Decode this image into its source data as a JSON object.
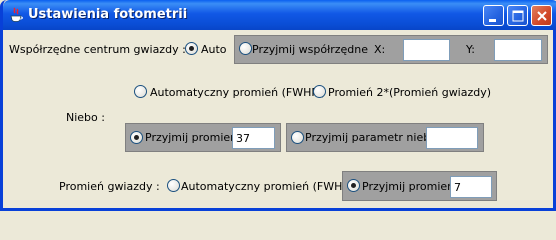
{
  "window": {
    "title": "Ustawienia fotometrii",
    "controls": [
      "minimize-icon",
      "maximize-icon",
      "close-icon"
    ]
  },
  "star_center": {
    "label": "Współrzędne centrum gwiazdy :",
    "auto_label": "Auto",
    "auto_selected": true,
    "manual_label": "Przyjmij współrzędne",
    "manual_selected": false,
    "x_label": "X:",
    "x_value": "",
    "y_label": "Y:",
    "y_value": ""
  },
  "sky": {
    "label": "Niebo :",
    "auto_fwhm_label": "Automatyczny promień (FWHM)",
    "auto_fwhm_selected": false,
    "double_radius_label": "Promień 2*(Promień gwiazdy)",
    "double_radius_selected": false,
    "accept_radius_label": "Przyjmij promień",
    "accept_radius_selected": true,
    "radius_value": "37",
    "accept_param_label": "Przyjmij parametr nieba",
    "accept_param_selected": false,
    "param_value": ""
  },
  "star_radius": {
    "label": "Promień gwiazdy :",
    "auto_fwhm_label": "Automatyczny promień (FWHM)",
    "auto_fwhm_selected": false,
    "accept_radius_label": "Przyjmij promień",
    "accept_radius_selected": true,
    "radius_value": "7"
  },
  "colors": {
    "title_bar": "#0a4ed6",
    "window_bg": "#ece9d8",
    "panel_bg": "#a0a0a0"
  }
}
